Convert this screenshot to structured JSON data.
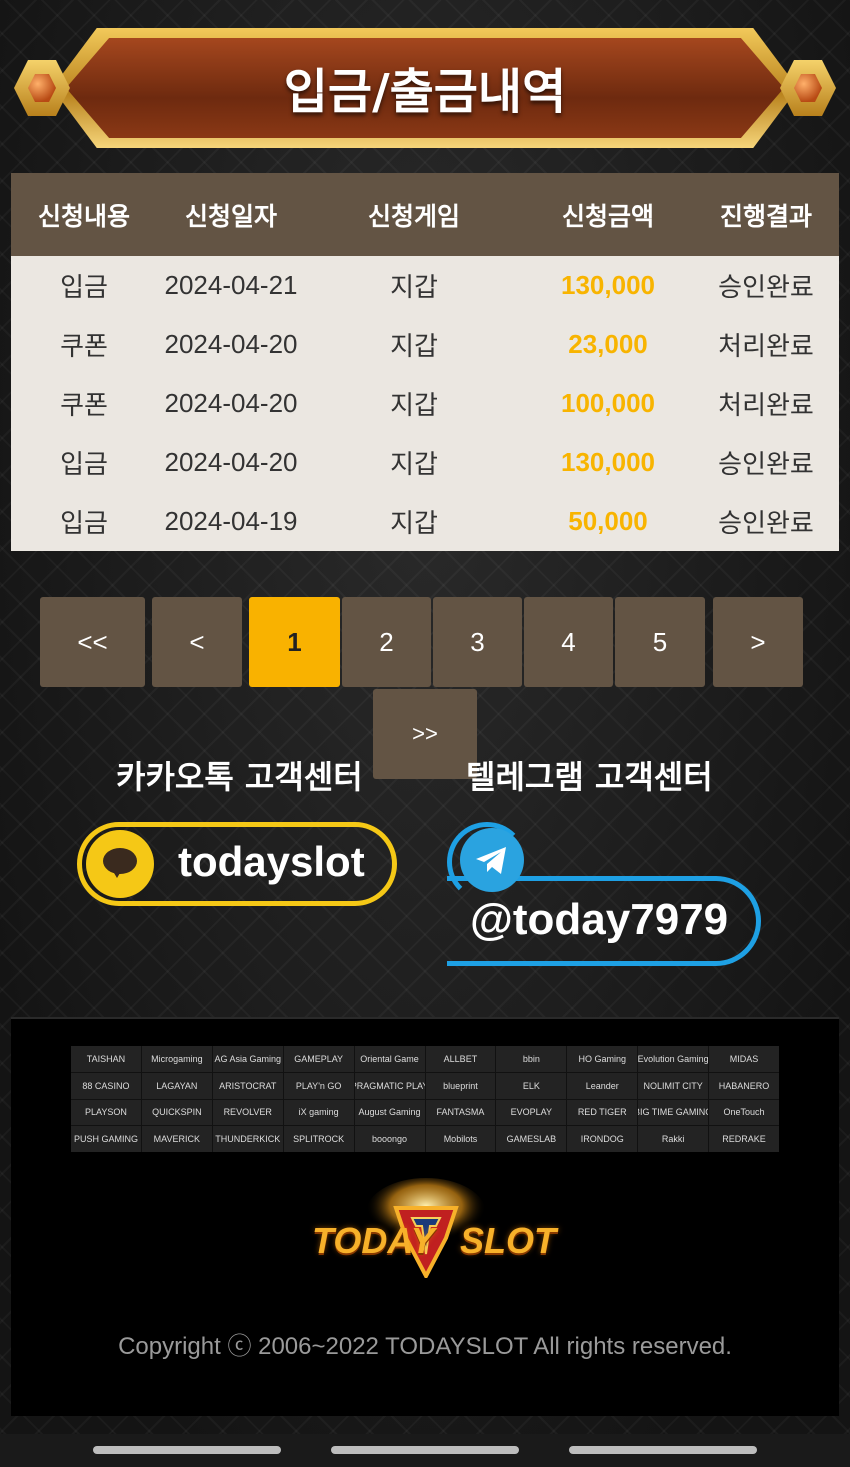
{
  "header": {
    "title": "입금/출금내역"
  },
  "table": {
    "columns": [
      "신청내용",
      "신청일자",
      "신청게임",
      "신청금액",
      "진행결과"
    ],
    "rows": [
      [
        "입금",
        "2024-04-21",
        "지갑",
        "130,000",
        "승인완료"
      ],
      [
        "쿠폰",
        "2024-04-20",
        "지갑",
        "23,000",
        "처리완료"
      ],
      [
        "쿠폰",
        "2024-04-20",
        "지갑",
        "100,000",
        "처리완료"
      ],
      [
        "입금",
        "2024-04-20",
        "지갑",
        "130,000",
        "승인완료"
      ],
      [
        "입금",
        "2024-04-19",
        "지갑",
        "50,000",
        "승인완료"
      ]
    ]
  },
  "pagination": {
    "first": "<<",
    "prev": "<",
    "pages": [
      "1",
      "2",
      "3",
      "4",
      "5"
    ],
    "current": "1",
    "next": ">",
    "last": ">>"
  },
  "support": {
    "kakao_title": "카카오톡 고객센터",
    "kakao_id": "todayslot",
    "telegram_title": "텔레그램 고객센터",
    "telegram_id": "@today7979"
  },
  "providers": [
    "TAISHAN",
    "Microgaming",
    "AG Asia Gaming",
    "GAMEPLAY",
    "Oriental Game",
    "ALLBET",
    "bbin",
    "HO Gaming",
    "Evolution Gaming",
    "MIDAS",
    "88 CASINO",
    "LAGAYAN",
    "ARISTOCRAT",
    "PLAY'n GO",
    "PRAGMATIC PLAY",
    "blueprint",
    "ELK",
    "Leander",
    "NOLIMIT CITY",
    "HABANERO",
    "PLAYSON",
    "QUICKSPIN",
    "REVOLVER",
    "iX gaming",
    "August Gaming",
    "FANTASMA",
    "EVOPLAY",
    "RED TIGER",
    "BIG TIME GAMING",
    "OneTouch",
    "PUSH GAMING",
    "MAVERICK",
    "THUNDERKICK",
    "SPLITROCK",
    "booongo",
    "Mobilots",
    "GAMESLAB",
    "IRONDOG",
    "Rakki",
    "REDRAKE"
  ],
  "brand": {
    "left": "TODAY",
    "right": "SLOT"
  },
  "footer": {
    "copyright": "Copyright ⓒ 2006~2022 TODAYSLOT All rights reserved."
  },
  "colors": {
    "header_bg": "#635444",
    "row_bg": "#ebe7e1",
    "amount": "#f8b400",
    "active_page": "#f9b200",
    "kakao": "#f5c816",
    "telegram": "#1ea0e4"
  }
}
